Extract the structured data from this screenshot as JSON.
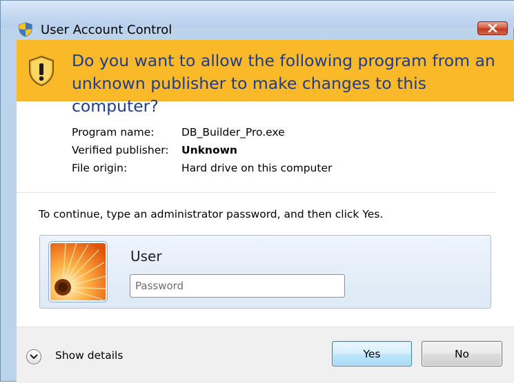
{
  "window": {
    "title": "User Account Control",
    "close_icon": "close-icon"
  },
  "banner": {
    "question": "Do you want to allow the following program from an unknown publisher to make changes to this computer?",
    "icon": "warning-shield-icon"
  },
  "program_info": [
    {
      "label": "Program name:",
      "value": "DB_Builder_Pro.exe",
      "bold": false
    },
    {
      "label": "Verified publisher:",
      "value": "Unknown",
      "bold": true
    },
    {
      "label": "File origin:",
      "value": "Hard drive on this computer",
      "bold": false
    }
  ],
  "credentials": {
    "instruction": "To continue, type an administrator password, and then click Yes.",
    "user_name": "User",
    "password_placeholder": "Password",
    "password_value": ""
  },
  "footer": {
    "show_details_label": "Show details",
    "yes_label": "Yes",
    "no_label": "No"
  },
  "colors": {
    "banner_background": "#f9b929",
    "banner_text": "#1f3d8c",
    "title_bar": "#c5d9f1",
    "close_button": "#c13a1f"
  }
}
